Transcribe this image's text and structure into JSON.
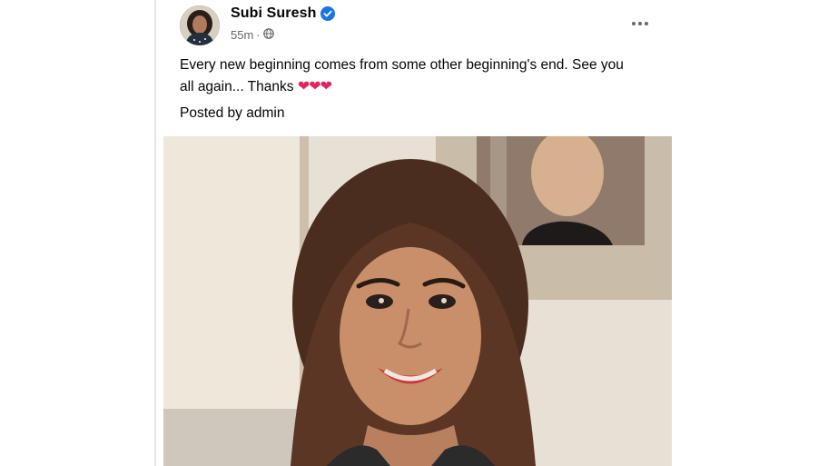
{
  "post": {
    "author": "Subi Suresh",
    "time": "55m",
    "audience_icon": "globe-icon",
    "verified_icon": "verified-badge-icon",
    "more_icon": "more-horizontal-icon",
    "text": "Every new beginning comes from some other beginning's end. See you all again... Thanks",
    "emoji": "❤❤❤",
    "posted_by": "Posted by admin",
    "image_description": "Photo of a smiling woman with shoulder-length brown hair in front of a framed poster"
  },
  "colors": {
    "accent_verified": "#1b74e4",
    "meta_text": "#65676b",
    "body_text": "#050505"
  }
}
